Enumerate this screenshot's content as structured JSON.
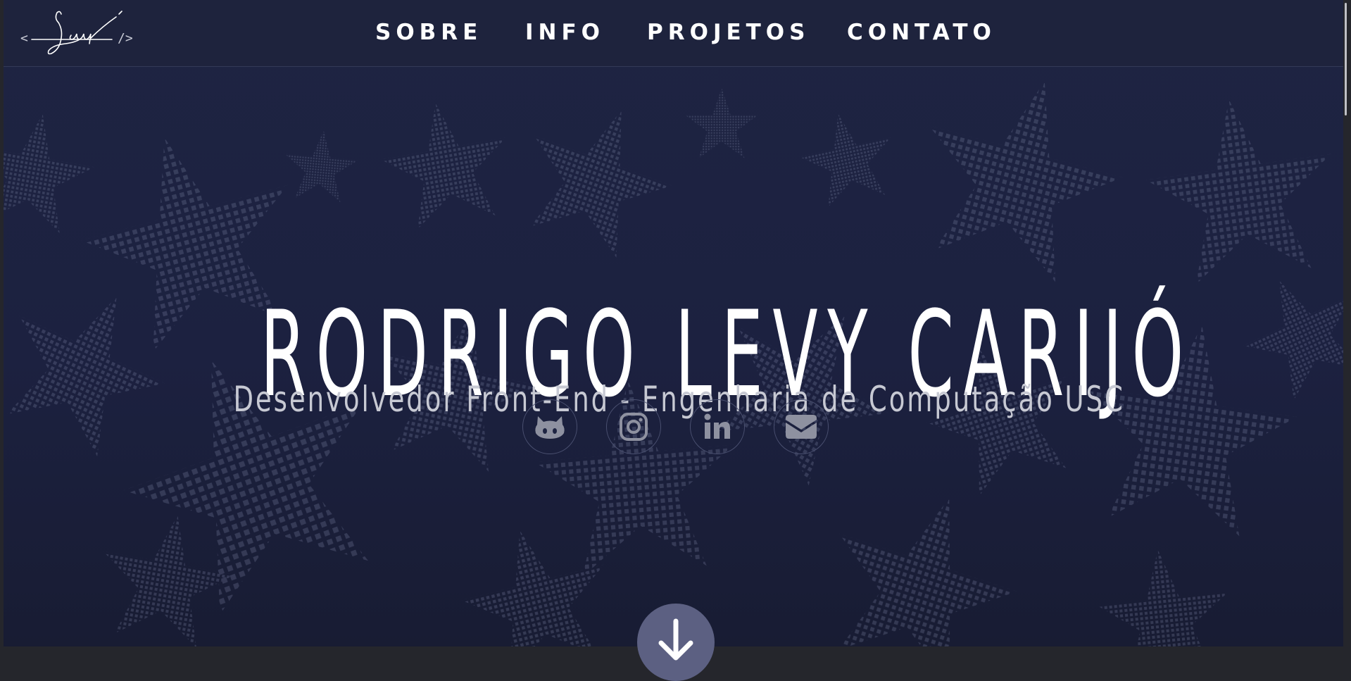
{
  "logo": {
    "alt": "Levy signature logo",
    "left_bracket": "<",
    "right_bracket": "/>"
  },
  "nav": {
    "items": [
      "SOBRE",
      "INFO",
      "PROJETOS",
      "CONTATO"
    ]
  },
  "hero": {
    "name": "RODRIGO LEVY CARIJÓ",
    "subtitle": "Desenvolvedor Front-End - Engenharia de Computação USC"
  },
  "social": [
    {
      "icon": "github-icon"
    },
    {
      "icon": "instagram-icon"
    },
    {
      "icon": "linkedin-icon"
    },
    {
      "icon": "email-icon"
    }
  ],
  "scroll_button": {
    "icon": "arrow-down-icon"
  },
  "colors": {
    "hero_bg": "#1e2442",
    "nav_bg": "#1e233d",
    "accent": "#5c6082",
    "icon": "#8e91a0",
    "text": "#ffffff"
  }
}
